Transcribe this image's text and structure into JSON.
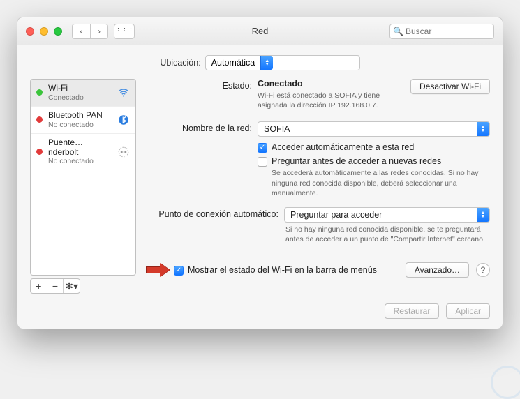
{
  "window": {
    "title": "Red"
  },
  "search": {
    "placeholder": "Buscar"
  },
  "location": {
    "label": "Ubicación:",
    "value": "Automática"
  },
  "sidebar": {
    "items": [
      {
        "name": "Wi-Fi",
        "status": "Conectado",
        "dot": "green",
        "icon": "wifi"
      },
      {
        "name": "Bluetooth PAN",
        "status": "No conectado",
        "dot": "red",
        "icon": "bluetooth"
      },
      {
        "name": "Puente…nderbolt",
        "status": "No conectado",
        "dot": "red",
        "icon": "bridge"
      }
    ]
  },
  "main": {
    "status_label": "Estado:",
    "status_value": "Conectado",
    "status_hint": "Wi-Fi está conectado a SOFIA y tiene asignada la dirección IP 192.168.0.7.",
    "toggle_label": "Desactivar Wi-Fi",
    "network_label": "Nombre de la red:",
    "network_value": "SOFIA",
    "auto_join": "Acceder automáticamente a esta red",
    "ask_new": "Preguntar antes de acceder a nuevas redes",
    "ask_new_hint": "Se accederá automáticamente a las redes conocidas. Si no hay ninguna red conocida disponible, deberá seleccionar una manualmente.",
    "hotspot_label": "Punto de conexión automático:",
    "hotspot_value": "Preguntar para acceder",
    "hotspot_hint": "Si no hay ninguna red conocida disponible, se te preguntará antes de acceder a un punto de \"Compartir Internet\" cercano.",
    "show_menubar": "Mostrar el estado del Wi-Fi en la barra de menús",
    "advanced": "Avanzado…"
  },
  "footer": {
    "revert": "Restaurar",
    "apply": "Aplicar"
  }
}
